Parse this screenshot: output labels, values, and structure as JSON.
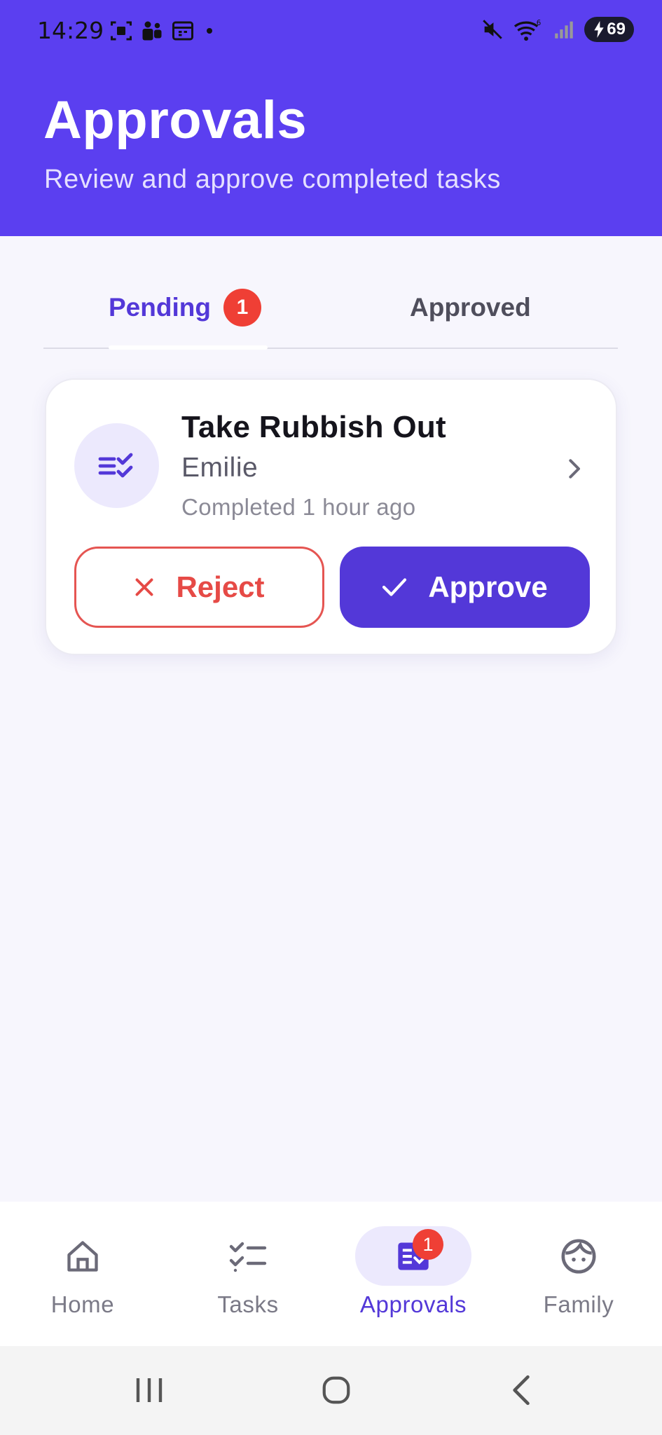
{
  "status_bar": {
    "time": "14:29",
    "battery": "69",
    "wifi_label": "6"
  },
  "header": {
    "title": "Approvals",
    "subtitle": "Review and approve completed tasks"
  },
  "tabs": [
    {
      "label": "Pending",
      "badge": "1",
      "active": true
    },
    {
      "label": "Approved",
      "active": false
    }
  ],
  "approval_card": {
    "task_name": "Take Rubbish Out",
    "person": "Emilie",
    "completed_time": "Completed 1 hour ago",
    "icon": "checklist-icon",
    "reject_label": "Reject",
    "approve_label": "Approve"
  },
  "bottom_nav": {
    "items": [
      {
        "label": "Home",
        "icon": "home-icon",
        "active": false
      },
      {
        "label": "Tasks",
        "icon": "tasks-icon",
        "active": false
      },
      {
        "label": "Approvals",
        "icon": "approvals-icon",
        "active": true,
        "badge": "1"
      },
      {
        "label": "Family",
        "icon": "face-icon",
        "active": false
      }
    ]
  },
  "colors": {
    "brand": "#5b3ff0",
    "accent": "#5338d8",
    "danger": "#ef3f35",
    "background": "#f7f6fd"
  }
}
